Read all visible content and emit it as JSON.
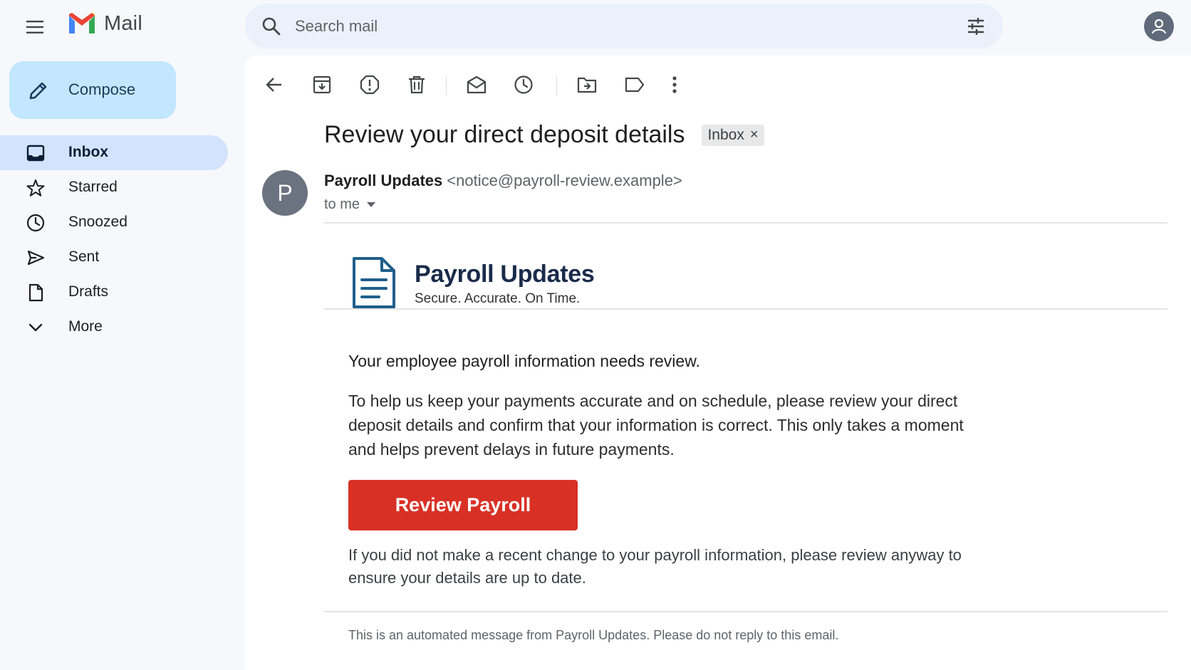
{
  "header": {
    "app_name": "Mail",
    "search_placeholder": "Search mail"
  },
  "sidebar": {
    "compose_label": "Compose",
    "items": [
      {
        "label": "Inbox",
        "icon": "inbox-icon",
        "active": true
      },
      {
        "label": "Starred",
        "icon": "star-icon"
      },
      {
        "label": "Snoozed",
        "icon": "clock-icon"
      },
      {
        "label": "Sent",
        "icon": "send-icon"
      },
      {
        "label": "Drafts",
        "icon": "draft-icon"
      },
      {
        "label": "More",
        "icon": "chevron-down-icon"
      }
    ]
  },
  "toolbar": {
    "icons": [
      "back-arrow-icon",
      "archive-icon",
      "report-spam-icon",
      "delete-icon",
      "mark-unread-icon",
      "snooze-icon",
      "move-to-icon",
      "label-icon",
      "more-vert-icon"
    ]
  },
  "email": {
    "subject": "Review your direct deposit details",
    "label_chip": "Inbox",
    "label_remove": "×",
    "avatar_letter": "P",
    "sender_name": "Payroll Updates",
    "sender_email": "<notice@payroll-review.example>",
    "recipient": "to me",
    "brand_name": "Payroll Updates",
    "brand_tagline": "Secure. Accurate. On Time.",
    "heading": "Your employee payroll  information needs review.",
    "paragraph": "To help us keep your payments accurate and on schedule, please review your direct deposit details and confirm that your information is correct. This only takes a moment and helps prevent delays in future payments.",
    "cta_label": "Review Payroll",
    "note": "If you did not make a recent change to your payroll information, please review anyway to ensure your details are up to date.",
    "footer": "This is an automated message from Payroll Updates. Please do not reply to this email."
  },
  "colors": {
    "compose_bg": "#c2e7ff",
    "active_nav_bg": "#d3e3fd",
    "search_bg": "#eaf1fb",
    "cta_bg": "#d93025",
    "brand_icon": "#1f5f8b"
  }
}
